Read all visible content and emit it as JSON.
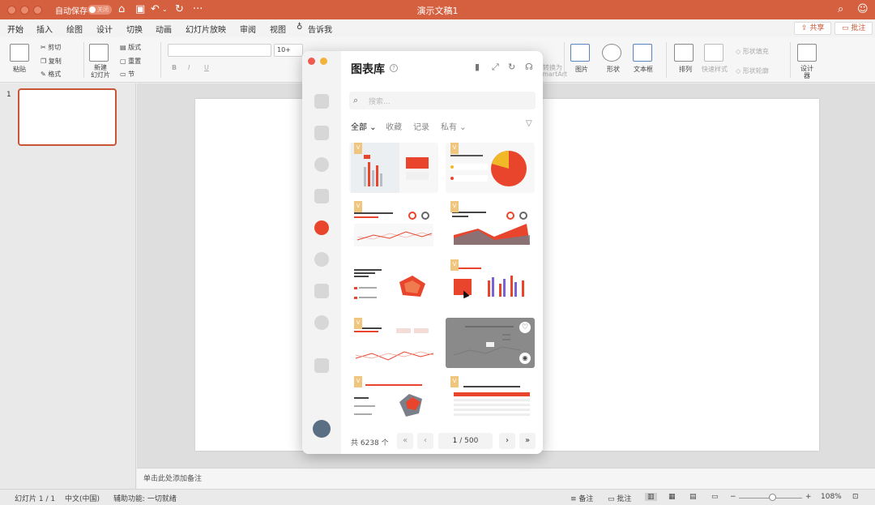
{
  "titlebar": {
    "autosave_label": "自动保存",
    "autosave_state": "关闭",
    "document_title": "演示文稿1"
  },
  "tabs": [
    "开始",
    "插入",
    "绘图",
    "设计",
    "切换",
    "动画",
    "幻灯片放映",
    "审阅",
    "视图"
  ],
  "tell_me": "告诉我",
  "share": {
    "share_label": "共享",
    "comment_label": "批注"
  },
  "ribbon": {
    "paste": "粘贴",
    "cut": "剪切",
    "copy": "复制",
    "format": "格式",
    "new_slide_line1": "新建",
    "new_slide_line2": "幻灯片",
    "layout": "版式",
    "reset": "重置",
    "section": "节",
    "font_size": "10+",
    "picture": "图片",
    "shape": "形状",
    "textbox": "文本框",
    "arrange": "排列",
    "quick_styles": "快速样式",
    "shape_fill": "形状填充",
    "shape_outline": "形状轮廓",
    "designer_line1": "设计",
    "designer_line2": "器",
    "smartart": "转换为",
    "smartart2": "SmartArt"
  },
  "slides_panel": {
    "slide_number": "1"
  },
  "notes_placeholder": "单击此处添加备注",
  "statusbar": {
    "slide_counter": "幻灯片 1 / 1",
    "language": "中文(中国)",
    "accessibility": "辅助功能: 一切就绪",
    "notes": "备注",
    "comments": "批注",
    "zoom": "108%"
  },
  "chart_library": {
    "title": "图表库",
    "search_placeholder": "搜索...",
    "filters": [
      "全部",
      "收藏",
      "记录",
      "私有"
    ],
    "active_filter": "全部",
    "badge": "V",
    "total_label": "共 6238 个",
    "page_current": "1",
    "page_total": "/ 500"
  },
  "colors": {
    "accent": "#d5603f",
    "chart_red": "#e8452c",
    "chart_yellow": "#f1b928"
  }
}
